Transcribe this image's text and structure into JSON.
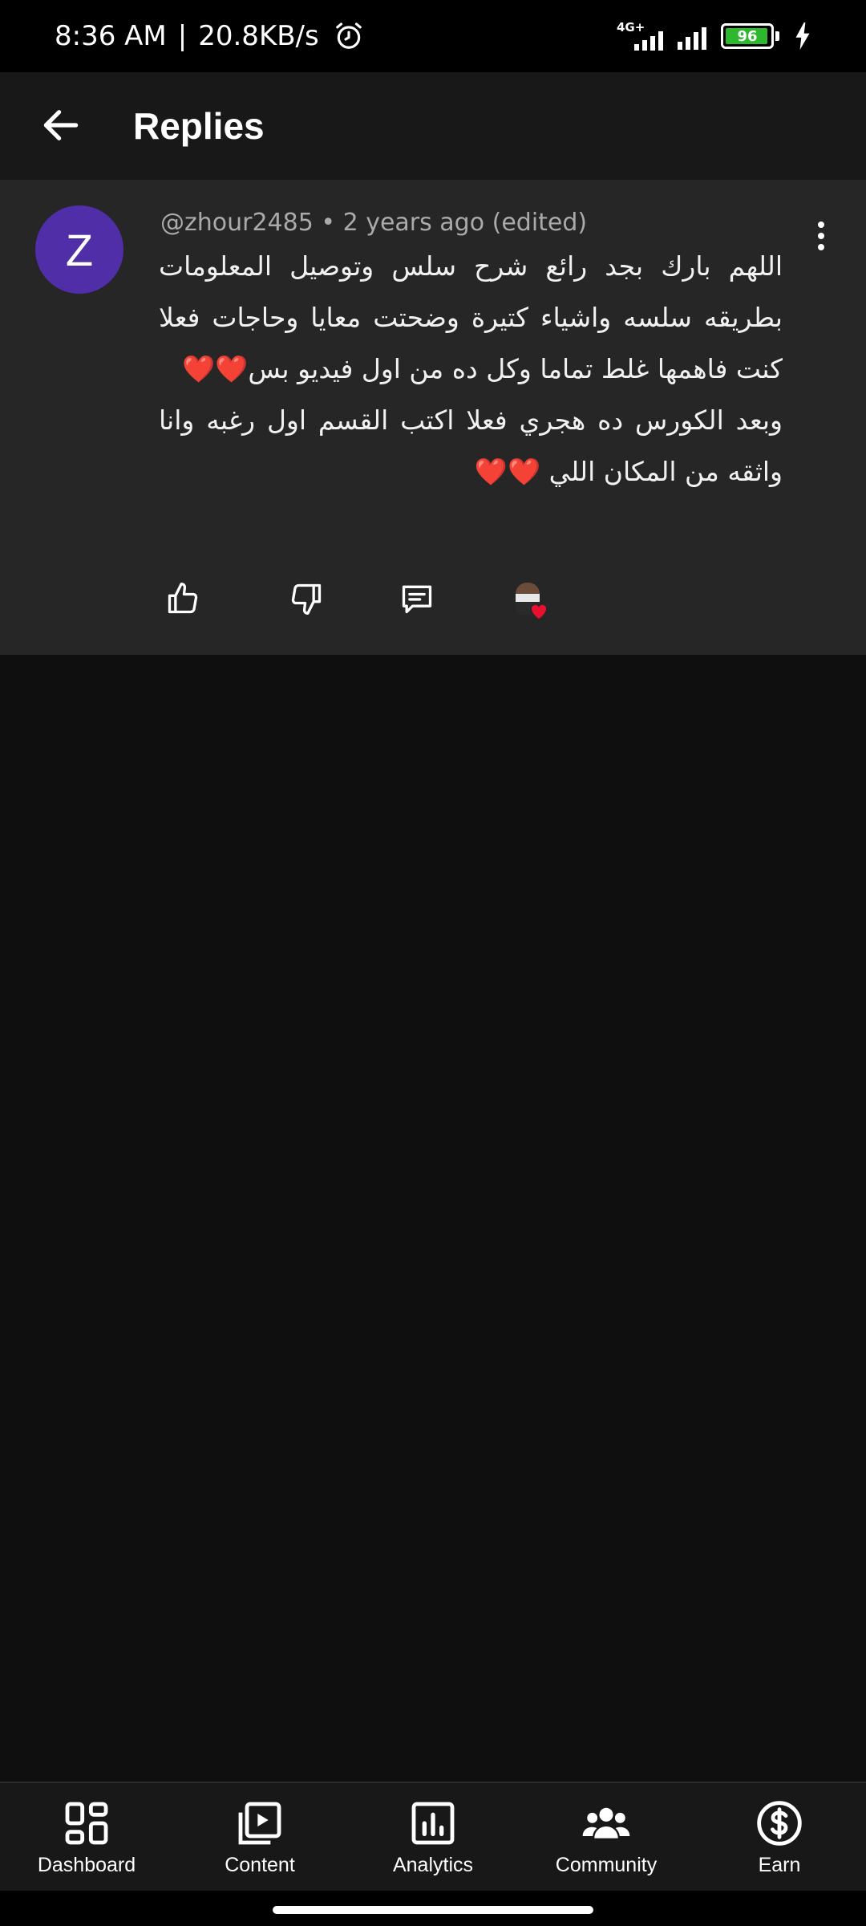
{
  "status_bar": {
    "time": "8:36 AM",
    "separator": "|",
    "net_speed": "20.8KB/s",
    "network_type": "4G+",
    "battery_percent": "96",
    "battery_level": 0.96,
    "alarm_icon": "alarm-clock-icon",
    "charging_icon": "lightning-bolt-icon"
  },
  "app_bar": {
    "title": "Replies",
    "back_icon": "arrow-left-icon"
  },
  "comment": {
    "avatar_letter": "Z",
    "avatar_color": "#4f2ea8",
    "meta": "@zhour2485 • 2 years ago (edited)",
    "text": "اللهم بارك بجد رائع شرح سلس وتوصيل المعلومات بطريقه سلسه واشياء كتيرة وضحتت معايا وحاجات فعلا كنت فاهمها غلط تماما وكل ده من اول فيديو بس❤️❤️\nوبعد الكورس ده هجري فعلا اكتب القسم اول رغبه وانا واثقه من المكان اللي ❤️❤️",
    "actions": [
      "thumbs-up-icon",
      "thumbs-down-icon",
      "reply-icon",
      "creator-heart-icon"
    ]
  },
  "bottom_nav": {
    "items": [
      {
        "label": "Dashboard",
        "icon": "dashboard-grid-icon"
      },
      {
        "label": "Content",
        "icon": "content-play-icon"
      },
      {
        "label": "Analytics",
        "icon": "analytics-bar-icon"
      },
      {
        "label": "Community",
        "icon": "community-people-icon"
      },
      {
        "label": "Earn",
        "icon": "earn-dollar-icon"
      }
    ]
  },
  "colors": {
    "background": "#0f0f0f",
    "card": "#262626",
    "accent_heart": "#e8102e",
    "battery_green": "#2eb82e"
  }
}
